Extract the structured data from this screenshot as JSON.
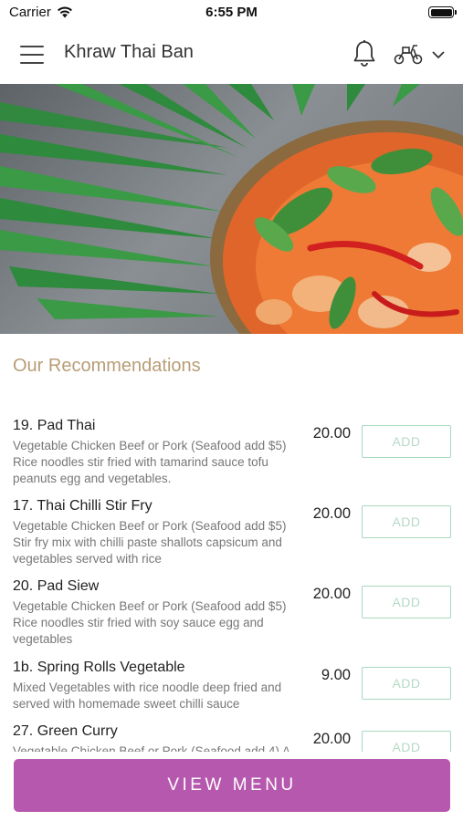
{
  "status_bar": {
    "carrier": "Carrier",
    "time": "6:55 PM"
  },
  "header": {
    "title": "Khraw Thai Ban",
    "icons": [
      "menu-icon",
      "bell-icon",
      "scooter-icon",
      "chevron-down-icon"
    ]
  },
  "section": {
    "title": "Our Recommendations"
  },
  "menu_items": [
    {
      "name": "19. Pad Thai",
      "description": "Vegetable Chicken Beef or Pork (Seafood add $5) Rice noodles stir fried with tamarind sauce tofu peanuts egg and vegetables.",
      "price": "20.00",
      "add_label": "ADD"
    },
    {
      "name": "17. Thai Chilli Stir Fry",
      "description": "Vegetable Chicken Beef or Pork (Seafood add $5) Stir fry mix with chilli paste shallots capsicum and vegetables served with rice",
      "price": "20.00",
      "add_label": "ADD"
    },
    {
      "name": "20. Pad Siew",
      "description": "Vegetable Chicken Beef or Pork (Seafood add $5) Rice noodles stir fried with soy sauce egg and vegetables",
      "price": "20.00",
      "add_label": "ADD"
    },
    {
      "name": "1b. Spring Rolls Vegetable",
      "description": "Mixed Vegetables with rice noodle deep fried and served with homemade sweet chilli sauce",
      "price": "9.00",
      "add_label": "ADD"
    },
    {
      "name": "27. Green Curry",
      "description": "Vegetable Chicken Beef or Pork (Seafood add 4) A",
      "price": "20.00",
      "add_label": "ADD"
    }
  ],
  "footer": {
    "button_label": "VIEW MENU"
  },
  "colors": {
    "accent_purple": "#b658ad",
    "section_title": "#b89d77",
    "add_border": "#a8d8bf"
  }
}
